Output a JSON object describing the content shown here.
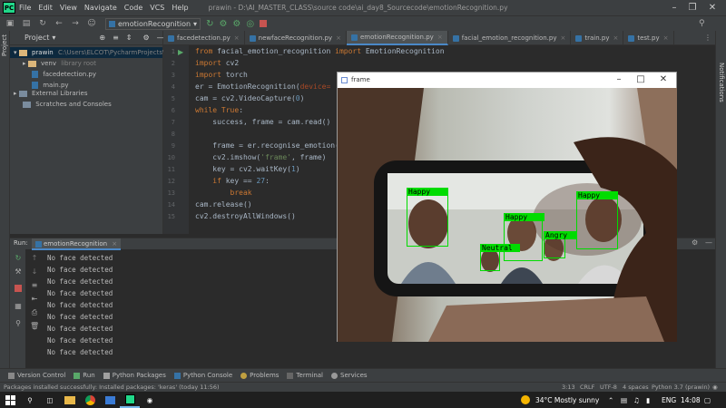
{
  "app": {
    "logo": "PC",
    "menu": [
      "File",
      "Edit",
      "View",
      "Navigate",
      "Code",
      "VCS",
      "Help"
    ],
    "window_title": "prawin - D:\\AI_MASTER_CLASS\\source code\\ai_day8_Sourcecode\\emotionRecognition.py"
  },
  "toolbar": {
    "run_config": "emotionRecognition"
  },
  "project": {
    "header": "Project",
    "root": "prawin",
    "root_path": "C:\\Users\\ELCOT\\PycharmProjects\\pr",
    "items": [
      {
        "label": "venv",
        "note": "library root"
      },
      {
        "label": "facedetection.py"
      },
      {
        "label": "main.py"
      },
      {
        "label": "External Libraries"
      },
      {
        "label": "Scratches and Consoles"
      }
    ]
  },
  "side": {
    "left_label": "Project",
    "right_label": "Notifications",
    "structure": "Structure"
  },
  "tabs": [
    "facedetection.py",
    "newfaceRecognition.py",
    "emotionRecognition.py",
    "facial_emotion_recognition.py",
    "train.py",
    "test.py"
  ],
  "active_tab": 2,
  "code": {
    "line_numbers": [
      "1",
      "2",
      "3",
      "4",
      "5",
      "6",
      "7",
      "8",
      "9",
      "10",
      "11",
      "12",
      "13",
      "14",
      "15"
    ],
    "l1a": "from",
    "l1b": " facial_emotion_recognition ",
    "l1c": "import",
    "l1d": " EmotionRecognition",
    "l2a": "import",
    "l2b": " cv2",
    "l3a": "import",
    "l3b": " torch",
    "l4a": "er = EmotionRecognition(",
    "l4b": "device=",
    "l5a": "cam = cv2.VideoCapture(",
    "l5b": "0",
    "l5c": ")",
    "l6a": "while",
    "l6b": " ",
    "l6c": "True",
    "l6d": ":",
    "l7": "    success, frame = cam.read()",
    "l9": "    frame = er.recognise_emotion(",
    "l10a": "    cv2.imshow(",
    "l10b": "'frame'",
    "l10c": ", frame)",
    "l11a": "    key = cv2.waitKey(",
    "l11b": "1",
    "l11c": ")",
    "l12a": "    if",
    "l12b": " key == ",
    "l12c": "27",
    "l12d": ":",
    "l13": "        break",
    "l14": "cam.release()",
    "l15": "cv2.destroyAllWindows()"
  },
  "run": {
    "label": "Run:",
    "tab": "emotionRecognition",
    "output": [
      "No face detected",
      "No face detected",
      "No face detected",
      "No face detected",
      "No face detected",
      "No face detected",
      "No face detected",
      "No face detected",
      "No face detected"
    ]
  },
  "frame_window": {
    "title": "frame",
    "faces": [
      {
        "label": "Happy"
      },
      {
        "label": "Happy"
      },
      {
        "label": "Happy"
      },
      {
        "label": "Neutral"
      },
      {
        "label": "Angry"
      }
    ]
  },
  "bottom_tabs": [
    "Version Control",
    "Run",
    "Python Packages",
    "Python Console",
    "Problems",
    "Terminal",
    "Services"
  ],
  "status": {
    "message": "Packages installed successfully: Installed packages: 'keras' (today 11:56)",
    "position": "3:13",
    "line_sep": "CRLF",
    "encoding": "UTF-8",
    "indent": "4 spaces",
    "interpreter": "Python 3.7 (prawin)"
  },
  "taskbar": {
    "weather": "34°C  Mostly sunny",
    "lang": "ENG",
    "time": "14:08"
  },
  "colors": {
    "accent": "#4a88c7",
    "box": "#00dc00",
    "keyword": "#cc7832"
  }
}
